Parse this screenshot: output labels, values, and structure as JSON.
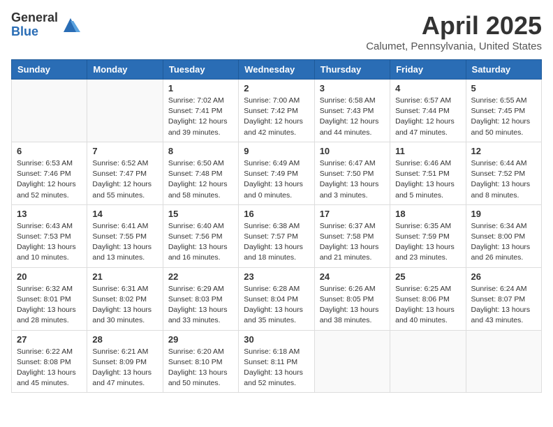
{
  "header": {
    "logo_general": "General",
    "logo_blue": "Blue",
    "month_title": "April 2025",
    "location": "Calumet, Pennsylvania, United States"
  },
  "weekdays": [
    "Sunday",
    "Monday",
    "Tuesday",
    "Wednesday",
    "Thursday",
    "Friday",
    "Saturday"
  ],
  "weeks": [
    [
      {
        "day": "",
        "info": ""
      },
      {
        "day": "",
        "info": ""
      },
      {
        "day": "1",
        "info": "Sunrise: 7:02 AM\nSunset: 7:41 PM\nDaylight: 12 hours and 39 minutes."
      },
      {
        "day": "2",
        "info": "Sunrise: 7:00 AM\nSunset: 7:42 PM\nDaylight: 12 hours and 42 minutes."
      },
      {
        "day": "3",
        "info": "Sunrise: 6:58 AM\nSunset: 7:43 PM\nDaylight: 12 hours and 44 minutes."
      },
      {
        "day": "4",
        "info": "Sunrise: 6:57 AM\nSunset: 7:44 PM\nDaylight: 12 hours and 47 minutes."
      },
      {
        "day": "5",
        "info": "Sunrise: 6:55 AM\nSunset: 7:45 PM\nDaylight: 12 hours and 50 minutes."
      }
    ],
    [
      {
        "day": "6",
        "info": "Sunrise: 6:53 AM\nSunset: 7:46 PM\nDaylight: 12 hours and 52 minutes."
      },
      {
        "day": "7",
        "info": "Sunrise: 6:52 AM\nSunset: 7:47 PM\nDaylight: 12 hours and 55 minutes."
      },
      {
        "day": "8",
        "info": "Sunrise: 6:50 AM\nSunset: 7:48 PM\nDaylight: 12 hours and 58 minutes."
      },
      {
        "day": "9",
        "info": "Sunrise: 6:49 AM\nSunset: 7:49 PM\nDaylight: 13 hours and 0 minutes."
      },
      {
        "day": "10",
        "info": "Sunrise: 6:47 AM\nSunset: 7:50 PM\nDaylight: 13 hours and 3 minutes."
      },
      {
        "day": "11",
        "info": "Sunrise: 6:46 AM\nSunset: 7:51 PM\nDaylight: 13 hours and 5 minutes."
      },
      {
        "day": "12",
        "info": "Sunrise: 6:44 AM\nSunset: 7:52 PM\nDaylight: 13 hours and 8 minutes."
      }
    ],
    [
      {
        "day": "13",
        "info": "Sunrise: 6:43 AM\nSunset: 7:53 PM\nDaylight: 13 hours and 10 minutes."
      },
      {
        "day": "14",
        "info": "Sunrise: 6:41 AM\nSunset: 7:55 PM\nDaylight: 13 hours and 13 minutes."
      },
      {
        "day": "15",
        "info": "Sunrise: 6:40 AM\nSunset: 7:56 PM\nDaylight: 13 hours and 16 minutes."
      },
      {
        "day": "16",
        "info": "Sunrise: 6:38 AM\nSunset: 7:57 PM\nDaylight: 13 hours and 18 minutes."
      },
      {
        "day": "17",
        "info": "Sunrise: 6:37 AM\nSunset: 7:58 PM\nDaylight: 13 hours and 21 minutes."
      },
      {
        "day": "18",
        "info": "Sunrise: 6:35 AM\nSunset: 7:59 PM\nDaylight: 13 hours and 23 minutes."
      },
      {
        "day": "19",
        "info": "Sunrise: 6:34 AM\nSunset: 8:00 PM\nDaylight: 13 hours and 26 minutes."
      }
    ],
    [
      {
        "day": "20",
        "info": "Sunrise: 6:32 AM\nSunset: 8:01 PM\nDaylight: 13 hours and 28 minutes."
      },
      {
        "day": "21",
        "info": "Sunrise: 6:31 AM\nSunset: 8:02 PM\nDaylight: 13 hours and 30 minutes."
      },
      {
        "day": "22",
        "info": "Sunrise: 6:29 AM\nSunset: 8:03 PM\nDaylight: 13 hours and 33 minutes."
      },
      {
        "day": "23",
        "info": "Sunrise: 6:28 AM\nSunset: 8:04 PM\nDaylight: 13 hours and 35 minutes."
      },
      {
        "day": "24",
        "info": "Sunrise: 6:26 AM\nSunset: 8:05 PM\nDaylight: 13 hours and 38 minutes."
      },
      {
        "day": "25",
        "info": "Sunrise: 6:25 AM\nSunset: 8:06 PM\nDaylight: 13 hours and 40 minutes."
      },
      {
        "day": "26",
        "info": "Sunrise: 6:24 AM\nSunset: 8:07 PM\nDaylight: 13 hours and 43 minutes."
      }
    ],
    [
      {
        "day": "27",
        "info": "Sunrise: 6:22 AM\nSunset: 8:08 PM\nDaylight: 13 hours and 45 minutes."
      },
      {
        "day": "28",
        "info": "Sunrise: 6:21 AM\nSunset: 8:09 PM\nDaylight: 13 hours and 47 minutes."
      },
      {
        "day": "29",
        "info": "Sunrise: 6:20 AM\nSunset: 8:10 PM\nDaylight: 13 hours and 50 minutes."
      },
      {
        "day": "30",
        "info": "Sunrise: 6:18 AM\nSunset: 8:11 PM\nDaylight: 13 hours and 52 minutes."
      },
      {
        "day": "",
        "info": ""
      },
      {
        "day": "",
        "info": ""
      },
      {
        "day": "",
        "info": ""
      }
    ]
  ]
}
